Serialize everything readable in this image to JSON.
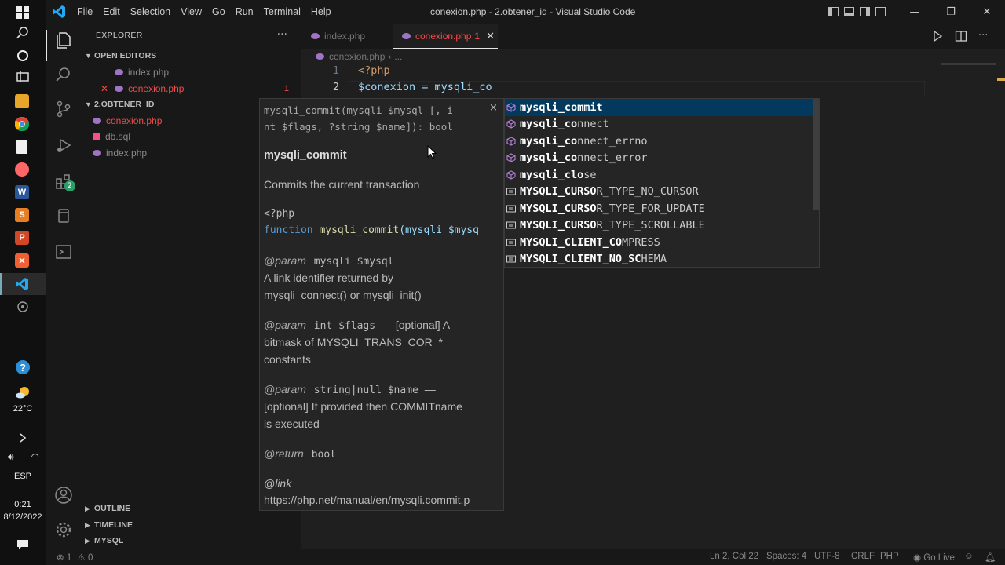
{
  "taskbar": {
    "temperature": "22°C",
    "language": "ESP",
    "time": "0:21",
    "date": "8/12/2022"
  },
  "titlebar": {
    "menu": [
      "File",
      "Edit",
      "Selection",
      "View",
      "Go",
      "Run",
      "Terminal",
      "Help"
    ],
    "title": "conexion.php - 2.obtener_id - Visual Studio Code"
  },
  "activity": {
    "extensions_badge": "2"
  },
  "sidebar": {
    "header": "EXPLORER",
    "more": "···",
    "open_editors_label": "OPEN EDITORS",
    "open_editors": [
      {
        "name": "index.php"
      },
      {
        "name": "conexion.php",
        "errors": "1"
      }
    ],
    "folder_label": "2.OBTENER_ID",
    "files": [
      {
        "name": "conexion.php"
      },
      {
        "name": "db.sql"
      },
      {
        "name": "index.php"
      }
    ],
    "outline_label": "OUTLINE",
    "timeline_label": "TIMELINE",
    "mysql_label": "MYSQL"
  },
  "tabs": [
    {
      "label": "index.php"
    },
    {
      "label": "conexion.php",
      "badge": "1",
      "close": "✕"
    }
  ],
  "breadcrumb": {
    "file": "conexion.php",
    "rest": "..."
  },
  "code": {
    "lines": [
      {
        "num": "1",
        "text": "<?php"
      },
      {
        "num": "2",
        "text": "$conexion = mysqli_co"
      }
    ]
  },
  "docs": {
    "signature_line1": "mysqli_commit(mysqli $mysql [, i",
    "signature_line2": "nt $flags, ?string $name]): bool",
    "close": "×",
    "title": "mysqli_commit",
    "summary": "Commits the current transaction",
    "example_open": "<?php",
    "example_kw": "function",
    "example_fn": "mysqli_commit",
    "example_rest": "(mysqli $mysq",
    "param1_tag": "@param",
    "param1_code": "mysqli $mysql",
    "param1_desc1": "A link identifier returned by",
    "param1_desc2": "mysqli_connect() or mysqli_init()",
    "param2_tag": "@param",
    "param2_code": "int $flags",
    "param2_desc1": "— [optional] A",
    "param2_desc2": "bitmask of MYSQLI_TRANS_COR_*",
    "param2_desc3": "constants",
    "param3_tag": "@param",
    "param3_code": "string|null $name",
    "param3_desc1": "—",
    "param3_desc2": "[optional] If provided then COMMITname",
    "param3_desc3": "is executed",
    "return_tag": "@return",
    "return_code": "bool",
    "link_tag": "@link",
    "link_url": "https://php.net/manual/en/mysqli.commit.p"
  },
  "suggestions": [
    {
      "kind": "method",
      "match": "mysqli_co",
      "rest": "mmit"
    },
    {
      "kind": "method",
      "match": "mysqli_co",
      "rest": "nnect"
    },
    {
      "kind": "method",
      "match": "mysqli_co",
      "rest": "nnect_errno"
    },
    {
      "kind": "method",
      "match": "mysqli_co",
      "rest": "nnect_error"
    },
    {
      "kind": "method",
      "match": "mysqli_clo",
      "rest": "se"
    },
    {
      "kind": "constant",
      "match": "MYSQLI_CURSO",
      "rest": "R_TYPE_NO_CURSOR"
    },
    {
      "kind": "constant",
      "match": "MYSQLI_CURSO",
      "rest": "R_TYPE_FOR_UPDATE"
    },
    {
      "kind": "constant",
      "match": "MYSQLI_CURSO",
      "rest": "R_TYPE_SCROLLABLE"
    },
    {
      "kind": "constant",
      "match": "MYSQLI_CLIENT_CO",
      "rest": "MPRESS"
    },
    {
      "kind": "constant",
      "match": "MYSQLI_CLIENT_NO_SC",
      "rest": "HEMA"
    }
  ],
  "status": {
    "errors": "1",
    "warnings": "0",
    "position": "Ln 2, Col 22",
    "spaces": "Spaces: 4",
    "encoding": "UTF-8",
    "eol": "CRLF",
    "language": "PHP",
    "golive": "Go Live"
  },
  "colors": {
    "accent_error": "#f14c4c",
    "php_icon": "#a074c4",
    "selection": "#04395e",
    "link": "#3ea0f8"
  }
}
